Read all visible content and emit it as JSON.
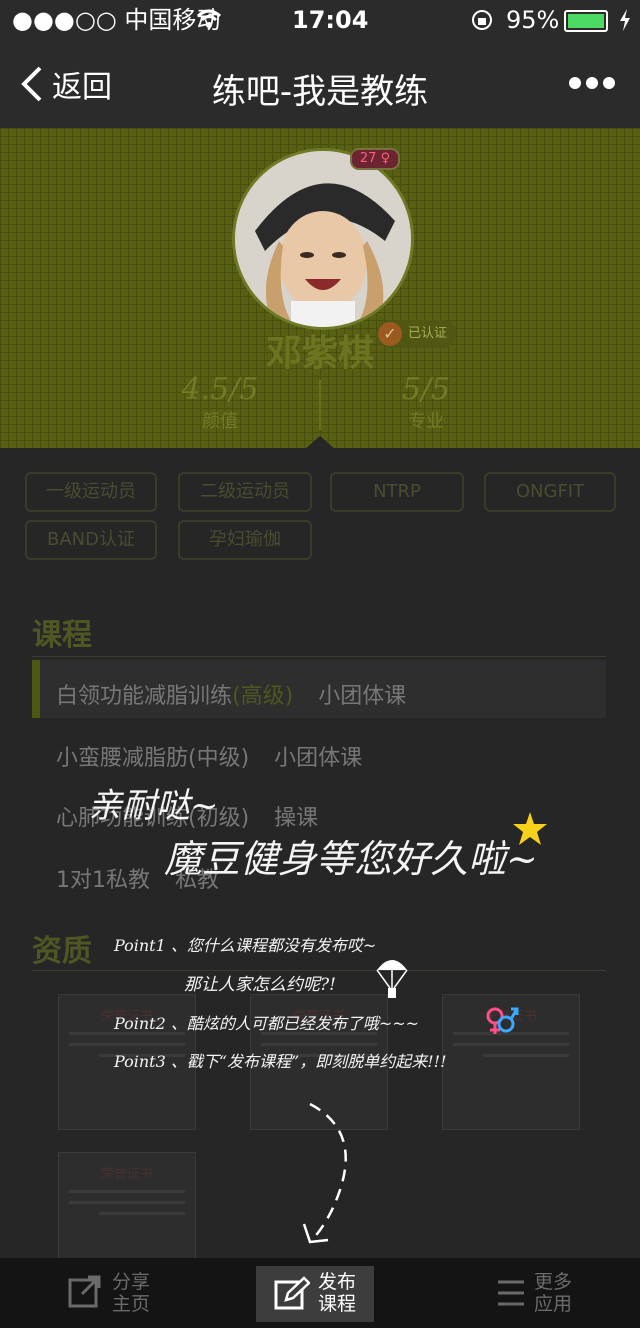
{
  "status": {
    "carrier": "●●●○○ 中国移动",
    "time": "17:04",
    "battery": "95%"
  },
  "nav": {
    "back_label": "返回",
    "title": "练吧-我是教练",
    "more_label": "•••"
  },
  "profile": {
    "name": "邓紫棋",
    "level": "27",
    "verified_label": "已认证",
    "scores": [
      {
        "value": "4.5/5",
        "label": "颜值"
      },
      {
        "value": "5/5",
        "label": "专业"
      }
    ]
  },
  "tags": [
    "一级运动员",
    "二级运动员",
    "NTRP",
    "ONGFIT",
    "BAND认证",
    "孕妇瑜伽"
  ],
  "courses": {
    "title": "课程",
    "items": [
      {
        "name": "白领功能减脂训练",
        "level": "(高级)",
        "type": "小团体课"
      },
      {
        "name": "小蛮腰减脂肪(中级)",
        "type": "小团体课"
      },
      {
        "name": "心肺功能训练(初级)",
        "type": "操课"
      },
      {
        "name": "1对1私教",
        "type": "私教"
      }
    ]
  },
  "qualifications": {
    "title": "资质",
    "cert_title": "荣誉证书"
  },
  "overlay": {
    "greeting": "亲耐哒~",
    "headline": "魔豆健身等您好久啦~",
    "points": [
      "Point1 、您什么课程都没有发布哎~",
      "那让人家怎么约呢?!",
      "Point2 、酷炫的人可都已经发布了哦~~~",
      "Point3 、戳下“发布课程”，即刻脱单约起来!!!"
    ]
  },
  "tabbar": {
    "share": [
      "分享",
      "主页"
    ],
    "publish": [
      "发布",
      "课程"
    ],
    "more": [
      "更多",
      "应用"
    ]
  },
  "colors": {
    "accent_olive": "#576012",
    "battery_green": "#4cd964",
    "badge_red": "#ff5f7c"
  }
}
